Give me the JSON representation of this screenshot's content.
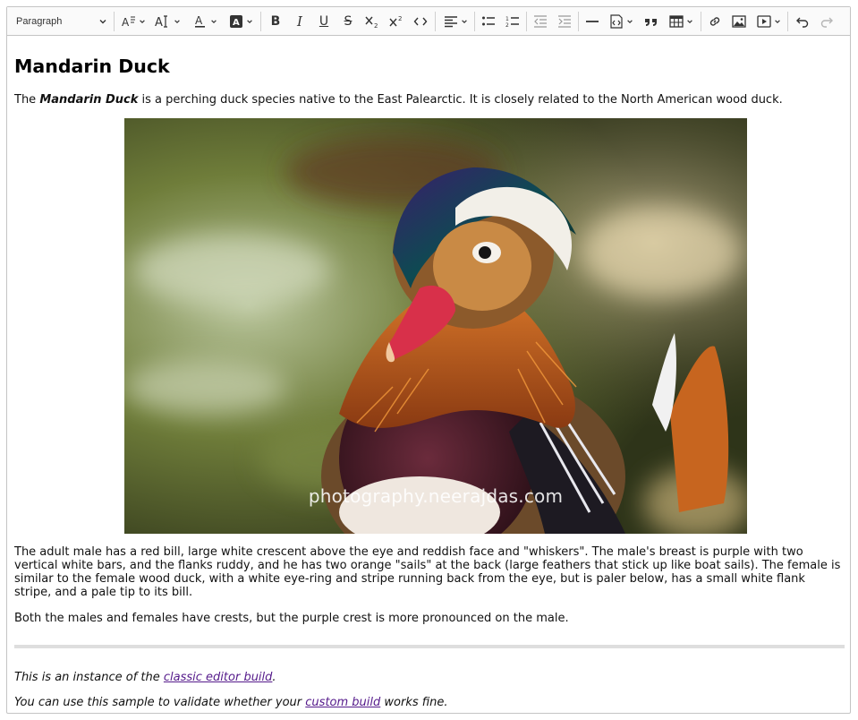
{
  "toolbar": {
    "heading_select": "Paragraph",
    "colors": {
      "icon": "#333333",
      "background": "#fafafa",
      "border": "#c4c4c4"
    },
    "icons": [
      "font-size-icon",
      "font-family-icon",
      "font-color-icon",
      "font-background-color-icon",
      "bold-icon",
      "italic-icon",
      "underline-icon",
      "strikethrough-icon",
      "subscript-icon",
      "superscript-icon",
      "code-icon",
      "alignment-icon",
      "bulleted-list-icon",
      "numbered-list-icon",
      "outdent-icon",
      "indent-icon",
      "horizontal-line-icon",
      "html-embed-icon",
      "block-quote-icon",
      "insert-table-icon",
      "link-icon",
      "insert-image-icon",
      "insert-media-icon",
      "undo-icon",
      "redo-icon"
    ],
    "bold_glyph": "B",
    "italic_glyph": "I",
    "underline_glyph": "U",
    "strike_glyph": "S",
    "code_glyph": "<>"
  },
  "document": {
    "heading": "Mandarin Duck",
    "intro": {
      "before": "The ",
      "emphasis": "Mandarin Duck",
      "after": " is a perching duck species native to the East Palearctic. It is closely related to the North American wood duck."
    },
    "image_watermark": "photography.neerajdas.com",
    "paragraph_male": "The adult male has a red bill, large white crescent above the eye and reddish face and \"whiskers\". The male's breast is purple with two vertical white bars, and the flanks ruddy, and he has two orange \"sails\" at the back (large feathers that stick up like boat sails). The female is similar to the female wood duck, with a white eye-ring and stripe running back from the eye, but is paler below, has a small white flank stripe, and a pale tip to its bill.",
    "paragraph_crests": "Both the males and females have crests, but the purple crest is more pronounced on the male.",
    "footer_line1": {
      "before": "This is an instance of the ",
      "link": "classic editor build",
      "after": "."
    },
    "footer_line2": {
      "before": "You can use this sample to validate whether your ",
      "link": "custom build",
      "after": " works fine."
    },
    "link_color": "#551a8b"
  }
}
